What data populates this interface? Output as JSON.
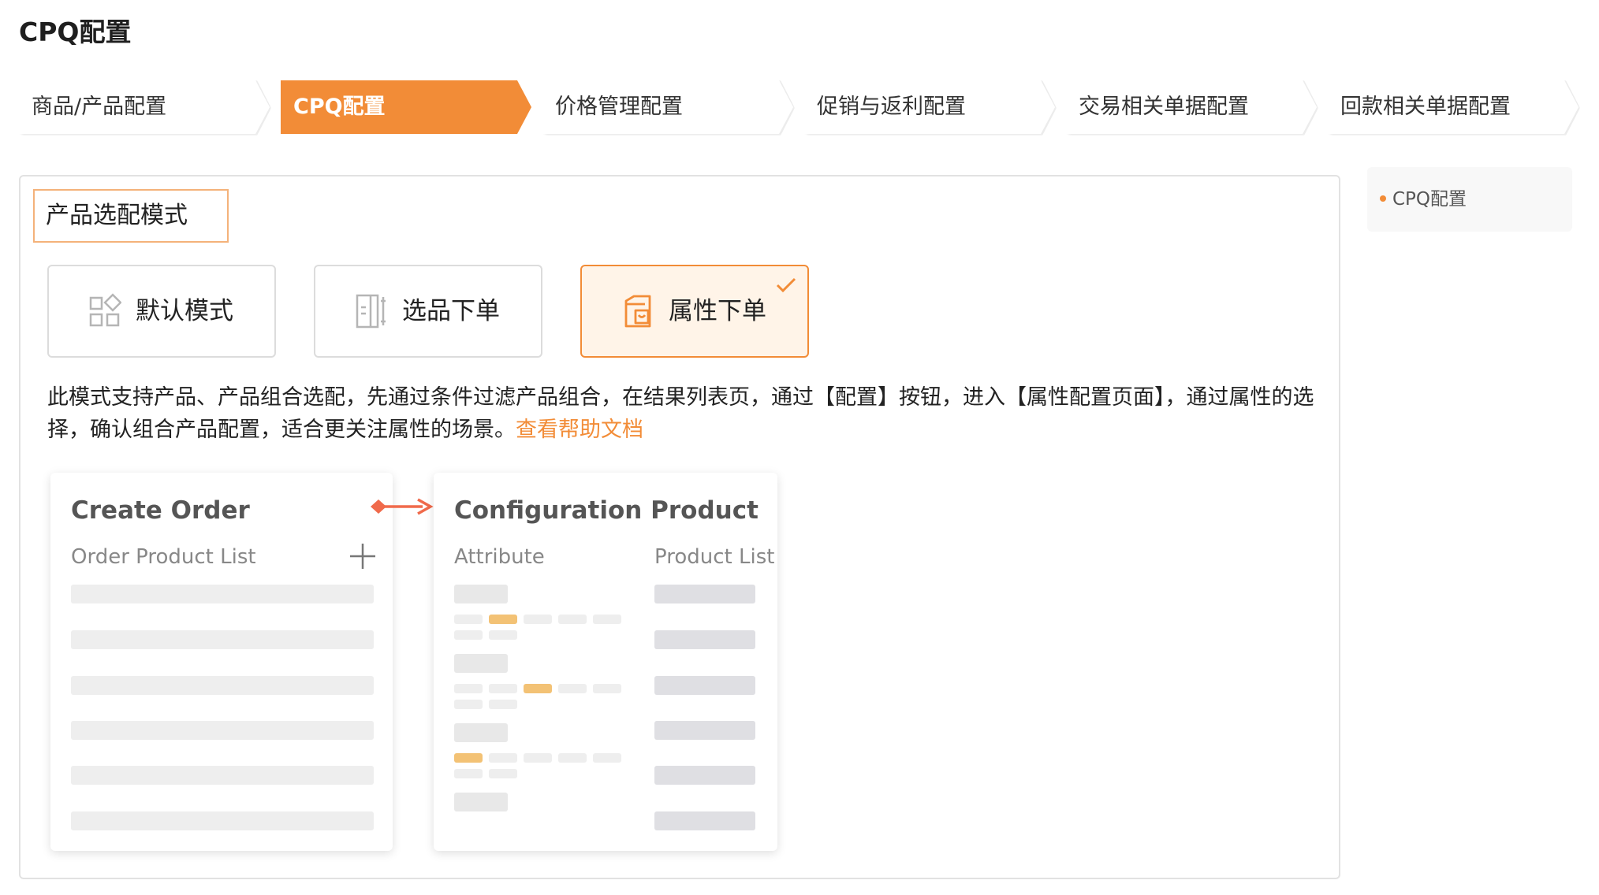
{
  "page": {
    "title": "CPQ配置"
  },
  "steps": [
    {
      "label": "商品/产品配置",
      "active": false
    },
    {
      "label": "CPQ配置",
      "active": true
    },
    {
      "label": "价格管理配置",
      "active": false
    },
    {
      "label": "促销与返利配置",
      "active": false
    },
    {
      "label": "交易相关单据配置",
      "active": false
    },
    {
      "label": "回款相关单据配置",
      "active": false
    }
  ],
  "section": {
    "title": "产品选配模式",
    "modes": [
      {
        "label": "默认模式",
        "icon": "grid-icon",
        "selected": false
      },
      {
        "label": "选品下单",
        "icon": "list-panel-icon",
        "selected": false
      },
      {
        "label": "属性下单",
        "icon": "cart-icon",
        "selected": true
      }
    ],
    "description": "此模式支持产品、产品组合选配，先通过条件过滤产品组合，在结果列表页，通过【配置】按钮，进入【属性配置页面】，通过属性的选择，确认组合产品配置，适合更关注属性的场景。",
    "help_link": "查看帮助文档"
  },
  "illustration": {
    "left_title": "Create Order",
    "left_sub": "Order Product List",
    "right_title": "Configuration Product",
    "right_sub_attr": "Attribute",
    "right_sub_list": "Product List"
  },
  "anchor_nav": {
    "items": [
      "CPQ配置"
    ]
  },
  "colors": {
    "accent": "#f28c37",
    "highlight_bar": "#f3c275",
    "arrow": "#f06a4b"
  }
}
